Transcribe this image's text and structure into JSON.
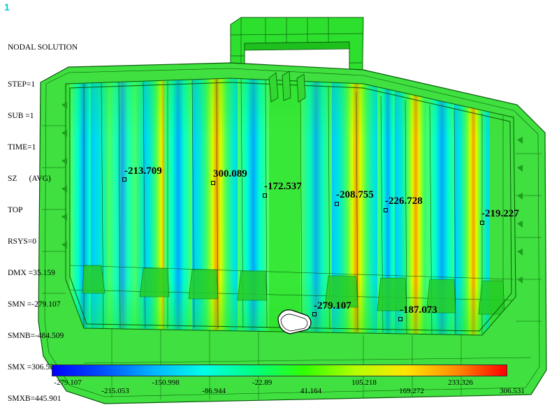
{
  "window_number": "1",
  "info_block": {
    "title": "NODAL SOLUTION",
    "lines": [
      "STEP=1",
      "SUB =1",
      "TIME=1",
      "SZ      (AVG)",
      "TOP",
      "RSYS=0",
      "DMX =35.159",
      "SMN =-279.107",
      "SMNB=-484.509",
      "SMX =306.531",
      "SMXB=445.901"
    ]
  },
  "probes": [
    {
      "label": "-213.709"
    },
    {
      "label": "300.089"
    },
    {
      "label": "-172.537"
    },
    {
      "label": "-208.755"
    },
    {
      "label": "-226.728"
    },
    {
      "label": "-219.227"
    },
    {
      "label": "-279.107"
    },
    {
      "label": "-187.073"
    }
  ],
  "colorbar": {
    "colors": [
      "#0000ff",
      "#0050ff",
      "#00b4ff",
      "#00ffe6",
      "#00ff80",
      "#30ff00",
      "#b4ff00",
      "#ffe600",
      "#ff8c00",
      "#ff0000"
    ],
    "min": -279.107,
    "max": 306.531,
    "ticks_bottom": [
      "-279.107",
      "-150.998",
      "-22.89",
      "105.218",
      "233.326"
    ],
    "ticks_top": [
      "-215.053",
      "-86.944",
      "41.164",
      "169.272",
      "306.531"
    ]
  }
}
